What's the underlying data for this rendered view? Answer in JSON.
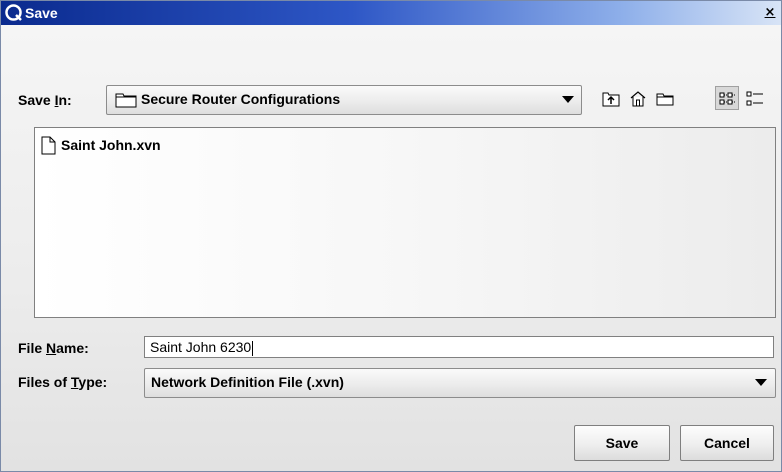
{
  "window": {
    "title": "Save"
  },
  "save_in": {
    "label_pre": "Save ",
    "label_mnemonic": "I",
    "label_post": "n:",
    "value": "Secure Router Configurations"
  },
  "toolbar": {
    "buttons": [
      "up-one-level-icon",
      "home-icon",
      "new-folder-icon",
      "list-view-icon",
      "details-view-icon"
    ]
  },
  "files": [
    {
      "name": "Saint John.xvn",
      "icon": "file-icon"
    }
  ],
  "file_name": {
    "label_pre": "File ",
    "label_mnemonic": "N",
    "label_post": "ame:",
    "value": "Saint John 6230"
  },
  "file_type": {
    "label_pre": "Files of ",
    "label_mnemonic": "T",
    "label_post": "ype:",
    "value": "Network Definition File (.xvn)"
  },
  "buttons": {
    "save": "Save",
    "cancel": "Cancel"
  }
}
